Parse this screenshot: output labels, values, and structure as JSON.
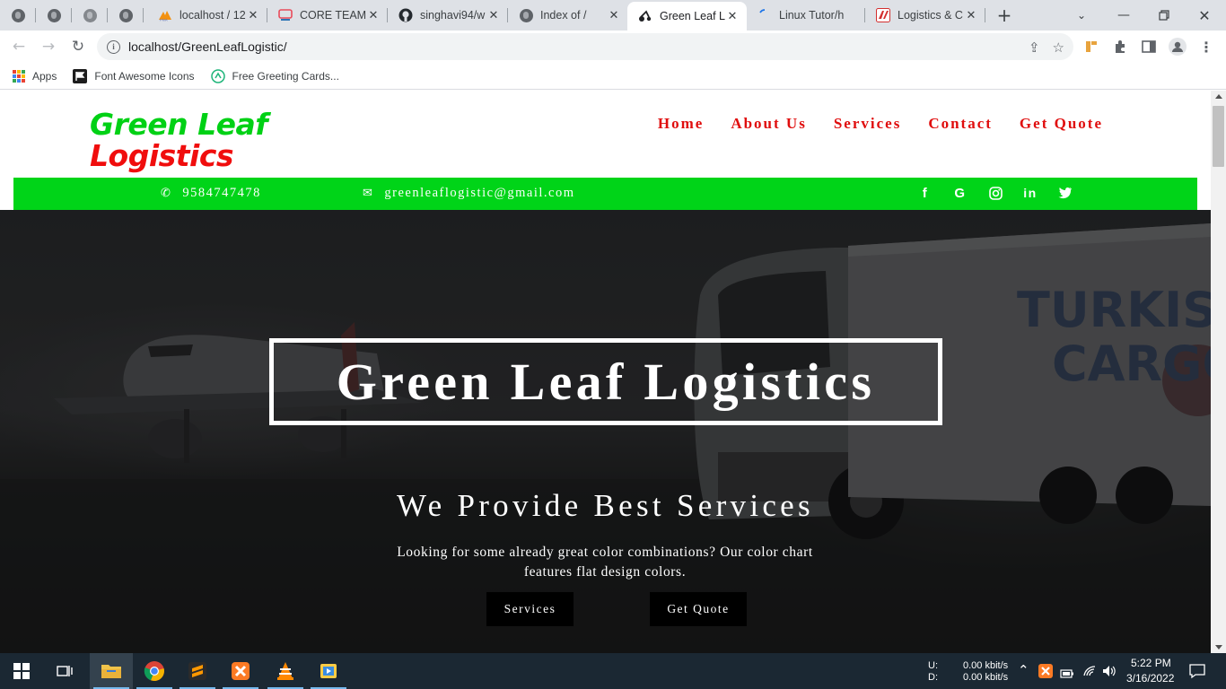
{
  "browser": {
    "tabs": [
      {
        "title": "",
        "icon": "globe-icon"
      },
      {
        "title": "",
        "icon": "globe-icon"
      },
      {
        "title": "",
        "icon": "globe-icon"
      },
      {
        "title": "",
        "icon": "globe-icon"
      },
      {
        "title": "localhost / 12",
        "icon": "phpmyadmin-icon"
      },
      {
        "title": "CORE TEAM",
        "icon": "core-team-icon"
      },
      {
        "title": "singhavi94/w",
        "icon": "github-icon"
      },
      {
        "title": "Index of /",
        "icon": "globe-icon"
      },
      {
        "title": "Green Leaf Lo",
        "icon": "page-icon",
        "active": true
      },
      {
        "title": "Linux Tutor/h",
        "icon": "loading-icon"
      },
      {
        "title": "Logistics & C",
        "icon": "logistics-icon"
      }
    ],
    "new_tab": "+",
    "address": "localhost/GreenLeafLogistic/",
    "bookmarks": [
      {
        "label": "Apps",
        "icon": "apps-grid-icon"
      },
      {
        "label": "Font Awesome Icons",
        "icon": "flag-icon"
      },
      {
        "label": "Free Greeting Cards...",
        "icon": "greeting-icon"
      }
    ]
  },
  "site": {
    "logo_line1": "Green Leaf",
    "logo_line2": "Logistics",
    "nav": [
      "Home",
      "About Us",
      "Services",
      "Contact",
      "Get Quote"
    ],
    "phone": "9584747478",
    "email": "greenleaflogistic@gmail.com",
    "socials": [
      "facebook-icon",
      "google-icon",
      "instagram-icon",
      "linkedin-icon",
      "twitter-icon"
    ],
    "hero": {
      "title": "Green Leaf Logistics",
      "subtitle": "We Provide Best Services",
      "description": "Looking for some already great color combinations? Our color chart features flat design colors.",
      "buttons": [
        "Services",
        "Get Quote"
      ],
      "truck_text_1": "TURKISH",
      "truck_text_2": "CARGO"
    },
    "colors": {
      "green": "#00d418",
      "red": "#e00d0d",
      "logo_green": "#00d115",
      "logo_red": "#f00d0d"
    }
  },
  "taskbar": {
    "net_up_label": "U:",
    "net_down_label": "D:",
    "net_up": "0.00 kbit/s",
    "net_down": "0.00 kbit/s",
    "time": "5:22 PM",
    "date": "3/16/2022"
  }
}
